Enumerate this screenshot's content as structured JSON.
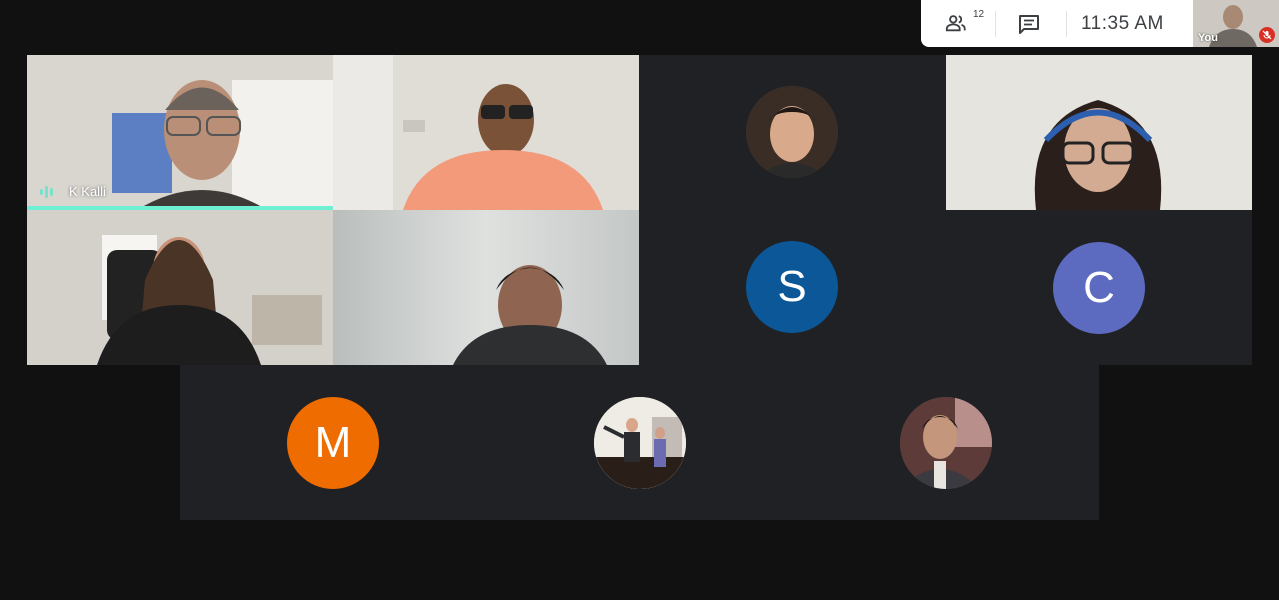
{
  "topbar": {
    "participants_count": "12",
    "participants_icon": "people-icon",
    "chat_icon": "chat-icon",
    "time": "11:35  AM",
    "self_label": "You",
    "self_mic_icon": "mic-off-icon"
  },
  "participants": {
    "active_speaker_name": "K Kalli",
    "speaking_icon": "audio-level-icon",
    "avatar_s": "S",
    "avatar_c": "C",
    "avatar_m": "M"
  },
  "colors": {
    "background": "#111112",
    "tile_background": "#202124",
    "active_speaker": "#6ff0d3",
    "avatar_s": "#0b5798",
    "avatar_c": "#5c6bc0",
    "avatar_m": "#ef6c00",
    "mic_off": "#d93025"
  }
}
